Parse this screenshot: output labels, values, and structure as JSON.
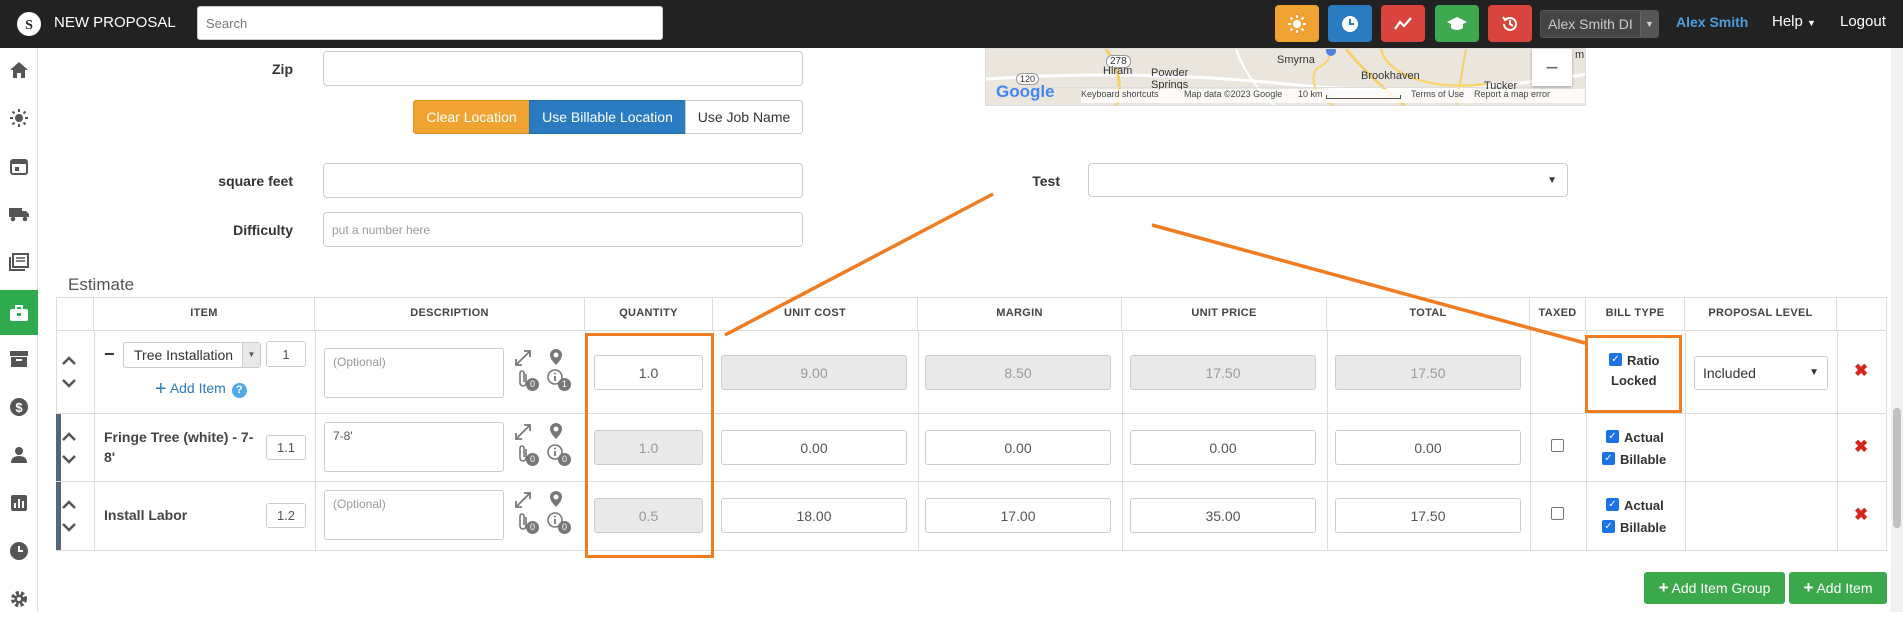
{
  "header": {
    "app_title": "NEW PROPOSAL",
    "search_placeholder": "Search",
    "user_select": "Alex Smith DI",
    "user_name": "Alex Smith",
    "help": "Help",
    "logout": "Logout",
    "colors": {
      "weather": "#f0a330",
      "clock": "#2b7bc0",
      "chart": "#d9443c",
      "learn": "#3fa950",
      "history": "#d9443c"
    }
  },
  "sidebar": {
    "icons": [
      "home-icon",
      "sun-icon",
      "calendar-icon",
      "truck-icon",
      "documents-icon",
      "briefcase-icon",
      "archive-icon",
      "dollar-icon",
      "user-icon",
      "bar-chart-icon",
      "clock-icon",
      "gear-icon"
    ],
    "active": "briefcase-icon",
    "accent": "#2eab4d"
  },
  "form": {
    "zip_label": "Zip",
    "clear_location": "Clear Location",
    "use_billable_location": "Use Billable Location",
    "use_job_name": "Use Job Name",
    "square_feet_label": "square feet",
    "difficulty_label": "Difficulty",
    "difficulty_placeholder": "put a number here",
    "test_label": "Test"
  },
  "map": {
    "places": [
      "Hiram",
      "Smyrna",
      "Powder Springs",
      "Brookhaven",
      "Tucker"
    ],
    "road_badge_1": "278",
    "road_badge_2": "120",
    "brand": "Google",
    "footer_shortcuts": "Keyboard shortcuts",
    "footer_data": "Map data ©2023 Google",
    "footer_scale": "10 km",
    "footer_terms": "Terms of Use",
    "footer_report": "Report a map error",
    "zoom_out": "−",
    "top_right_fragment": "m"
  },
  "estimate": {
    "title": "Estimate",
    "columns": [
      "ITEM",
      "DESCRIPTION",
      "QUANTITY",
      "UNIT COST",
      "MARGIN",
      "UNIT PRICE",
      "TOTAL",
      "TAXED",
      "BILL TYPE",
      "PROPOSAL LEVEL"
    ],
    "group": {
      "name": "Tree Installation",
      "index": "1",
      "add_item": "Add Item",
      "description_placeholder": "(Optional)",
      "quantity": "1.0",
      "unit_cost": "9.00",
      "margin": "8.50",
      "unit_price": "17.50",
      "total": "17.50",
      "bill_type_line1": "Ratio",
      "bill_type_line2": "Locked",
      "proposal_level": "Included",
      "attach_count": "0",
      "info_count": "1"
    },
    "rows": [
      {
        "name": "Fringe Tree (white) - 7-8'",
        "index": "1.1",
        "description": "7-8'",
        "quantity": "1.0",
        "unit_cost": "0.00",
        "margin": "0.00",
        "unit_price": "0.00",
        "total": "0.00",
        "taxed": false,
        "actual": "Actual",
        "billable": "Billable",
        "attach_count": "0",
        "info_count": "0"
      },
      {
        "name": "Install Labor",
        "index": "1.2",
        "description": "(Optional)",
        "quantity": "0.5",
        "unit_cost": "18.00",
        "margin": "17.00",
        "unit_price": "35.00",
        "total": "17.50",
        "taxed": false,
        "actual": "Actual",
        "billable": "Billable",
        "attach_count": "0",
        "info_count": "0"
      }
    ],
    "add_item_group": "Add Item Group",
    "add_item": "Add Item",
    "highlight_color": "#f07c21"
  }
}
